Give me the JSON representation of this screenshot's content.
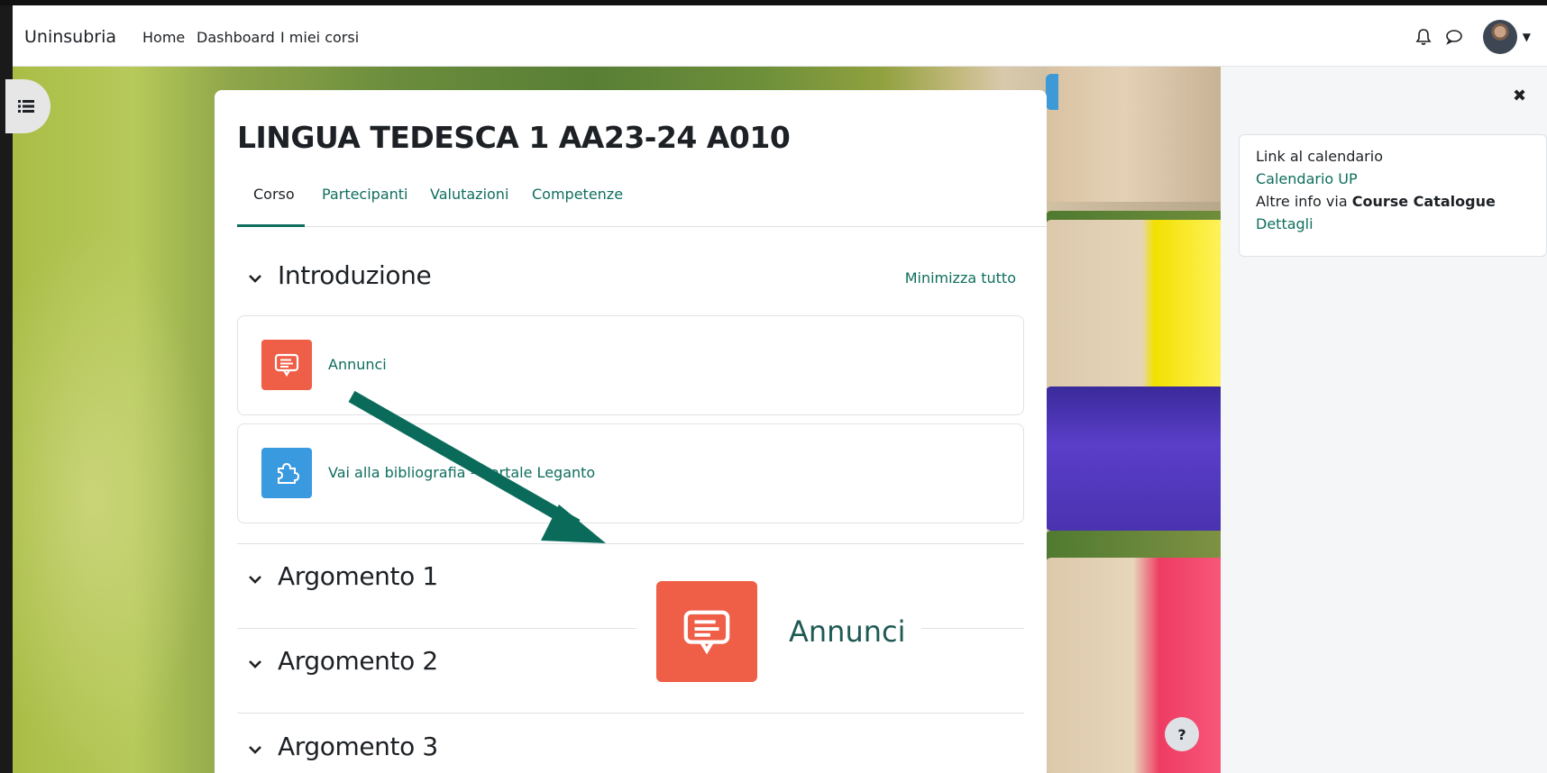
{
  "navbar": {
    "brand": "Uninsubria",
    "links": [
      "Home",
      "Dashboard",
      "I miei corsi"
    ]
  },
  "course": {
    "title": "LINGUA TEDESCA 1 AA23-24 A010",
    "tabs": [
      "Corso",
      "Partecipanti",
      "Valutazioni",
      "Competenze"
    ],
    "active_tab": "Corso",
    "collapse_all": "Minimizza tutto",
    "sections": [
      {
        "title": "Introduzione"
      },
      {
        "title": "Argomento 1"
      },
      {
        "title": "Argomento 2"
      },
      {
        "title": "Argomento 3"
      }
    ],
    "activities": [
      {
        "label": "Annunci",
        "icon": "forum-icon",
        "color": "#ef5e47"
      },
      {
        "label": "Vai alla bibliografia – Portale Leganto",
        "icon": "puzzle-icon",
        "color": "#3a9ae0"
      }
    ]
  },
  "zoom": {
    "label": "Annunci",
    "icon": "forum-icon",
    "color": "#ef5e47"
  },
  "arrow_color": "#0b6b5b",
  "right_drawer": {
    "line1": "Link al calendario",
    "link1": "Calendario UP",
    "line3_prefix": "Altre info via ",
    "line3_bold": "Course Catalogue",
    "link2": "Dettagli"
  },
  "help": "?"
}
